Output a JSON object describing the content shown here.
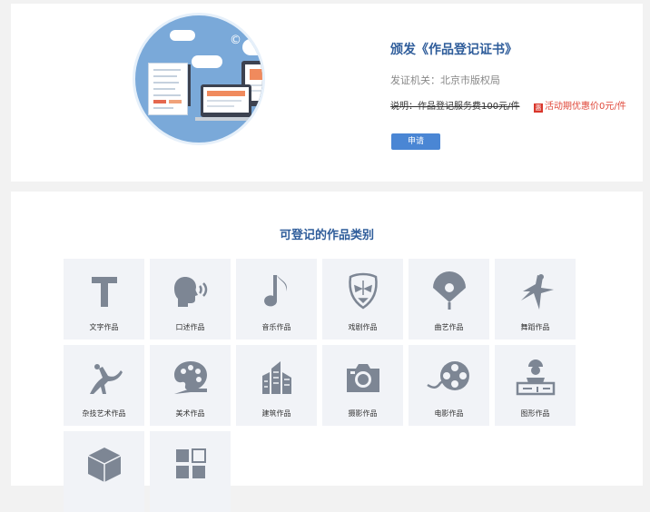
{
  "certificate": {
    "title": "颁发《作品登记证书》",
    "issuer": "发证机关：北京市版权局",
    "price_note": "说明：作品登记服务费100元/件",
    "promo": "活动期优惠价0元/件",
    "promo_icon": "惠",
    "apply_label": "申请"
  },
  "categories_section": {
    "title": "可登记的作品类别",
    "items": [
      {
        "label": "文字作品",
        "icon": "text-icon"
      },
      {
        "label": "口述作品",
        "icon": "speaking-head-icon"
      },
      {
        "label": "音乐作品",
        "icon": "music-note-icon"
      },
      {
        "label": "戏剧作品",
        "icon": "opera-mask-icon"
      },
      {
        "label": "曲艺作品",
        "icon": "folding-fan-icon"
      },
      {
        "label": "舞蹈作品",
        "icon": "dancer-icon"
      },
      {
        "label": "杂技艺术作品",
        "icon": "acrobat-icon"
      },
      {
        "label": "美术作品",
        "icon": "palette-icon"
      },
      {
        "label": "建筑作品",
        "icon": "buildings-icon"
      },
      {
        "label": "摄影作品",
        "icon": "camera-icon"
      },
      {
        "label": "电影作品",
        "icon": "film-reel-icon"
      },
      {
        "label": "图形作品",
        "icon": "blueprint-icon"
      },
      {
        "label": "",
        "icon": "cube-icon"
      },
      {
        "label": "",
        "icon": "grid-blocks-icon"
      }
    ]
  },
  "colors": {
    "accent": "#2e5c9a",
    "button": "#4a86d4",
    "promo": "#e0483a",
    "icon": "#7d8694",
    "tile_bg": "#f1f3f7"
  }
}
